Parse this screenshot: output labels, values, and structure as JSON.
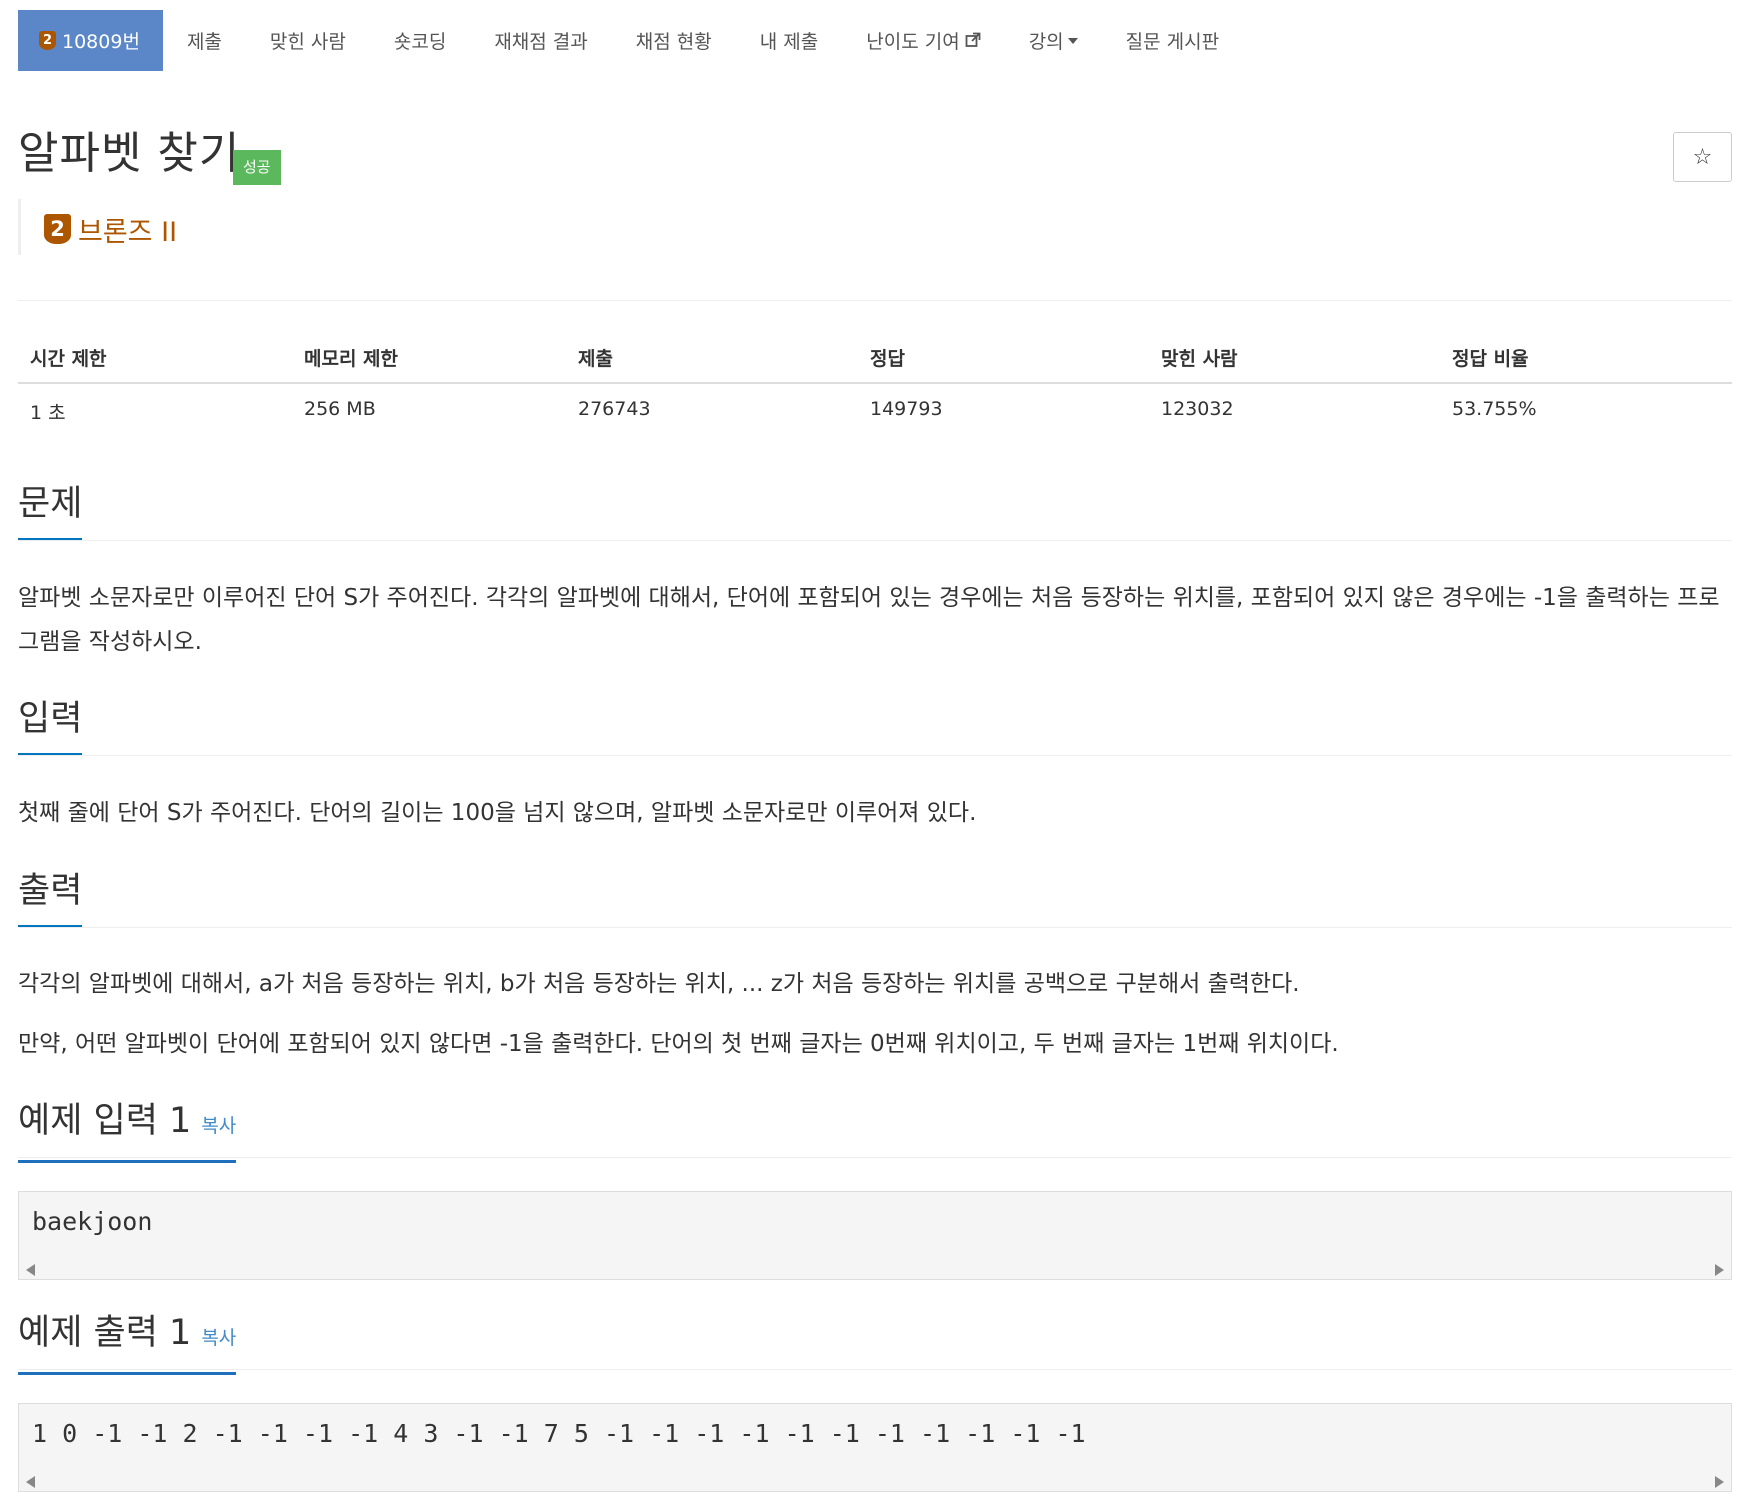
{
  "nav": {
    "problem_number": "10809번",
    "items": [
      "제출",
      "맞힌 사람",
      "숏코딩",
      "재채점 결과",
      "채점 현황",
      "내 제출",
      "난이도 기여",
      "강의",
      "질문 게시판"
    ],
    "tier_num": "2"
  },
  "problem": {
    "title": "알파벳 찾기",
    "status_badge": "성공",
    "star": "☆",
    "tier_num": "2",
    "tier_label": "브론즈 II"
  },
  "stats": {
    "headers": [
      "시간 제한",
      "메모리 제한",
      "제출",
      "정답",
      "맞힌 사람",
      "정답 비율"
    ],
    "values": [
      "1 초",
      "256 MB",
      "276743",
      "149793",
      "123032",
      "53.755%"
    ]
  },
  "sections": {
    "problem": {
      "title": "문제",
      "text": "알파벳 소문자로만 이루어진 단어 S가 주어진다. 각각의 알파벳에 대해서, 단어에 포함되어 있는 경우에는 처음 등장하는 위치를, 포함되어 있지 않은 경우에는 -1을 출력하는 프로그램을 작성하시오."
    },
    "input": {
      "title": "입력",
      "text": "첫째 줄에 단어 S가 주어진다. 단어의 길이는 100을 넘지 않으며, 알파벳 소문자로만 이루어져 있다."
    },
    "output": {
      "title": "출력",
      "text1": "각각의 알파벳에 대해서, a가 처음 등장하는 위치, b가 처음 등장하는 위치, ... z가 처음 등장하는 위치를 공백으로 구분해서 출력한다.",
      "text2": "만약, 어떤 알파벳이 단어에 포함되어 있지 않다면 -1을 출력한다. 단어의 첫 번째 글자는 0번째 위치이고, 두 번째 글자는 1번째 위치이다."
    },
    "sample_input": {
      "title": "예제 입력 1",
      "copy": "복사",
      "content": "baekjoon"
    },
    "sample_output": {
      "title": "예제 출력 1",
      "copy": "복사",
      "content": "1 0 -1 -1 2 -1 -1 -1 -1 4 3 -1 -1 7 5 -1 -1 -1 -1 -1 -1 -1 -1 -1 -1 -1"
    }
  }
}
